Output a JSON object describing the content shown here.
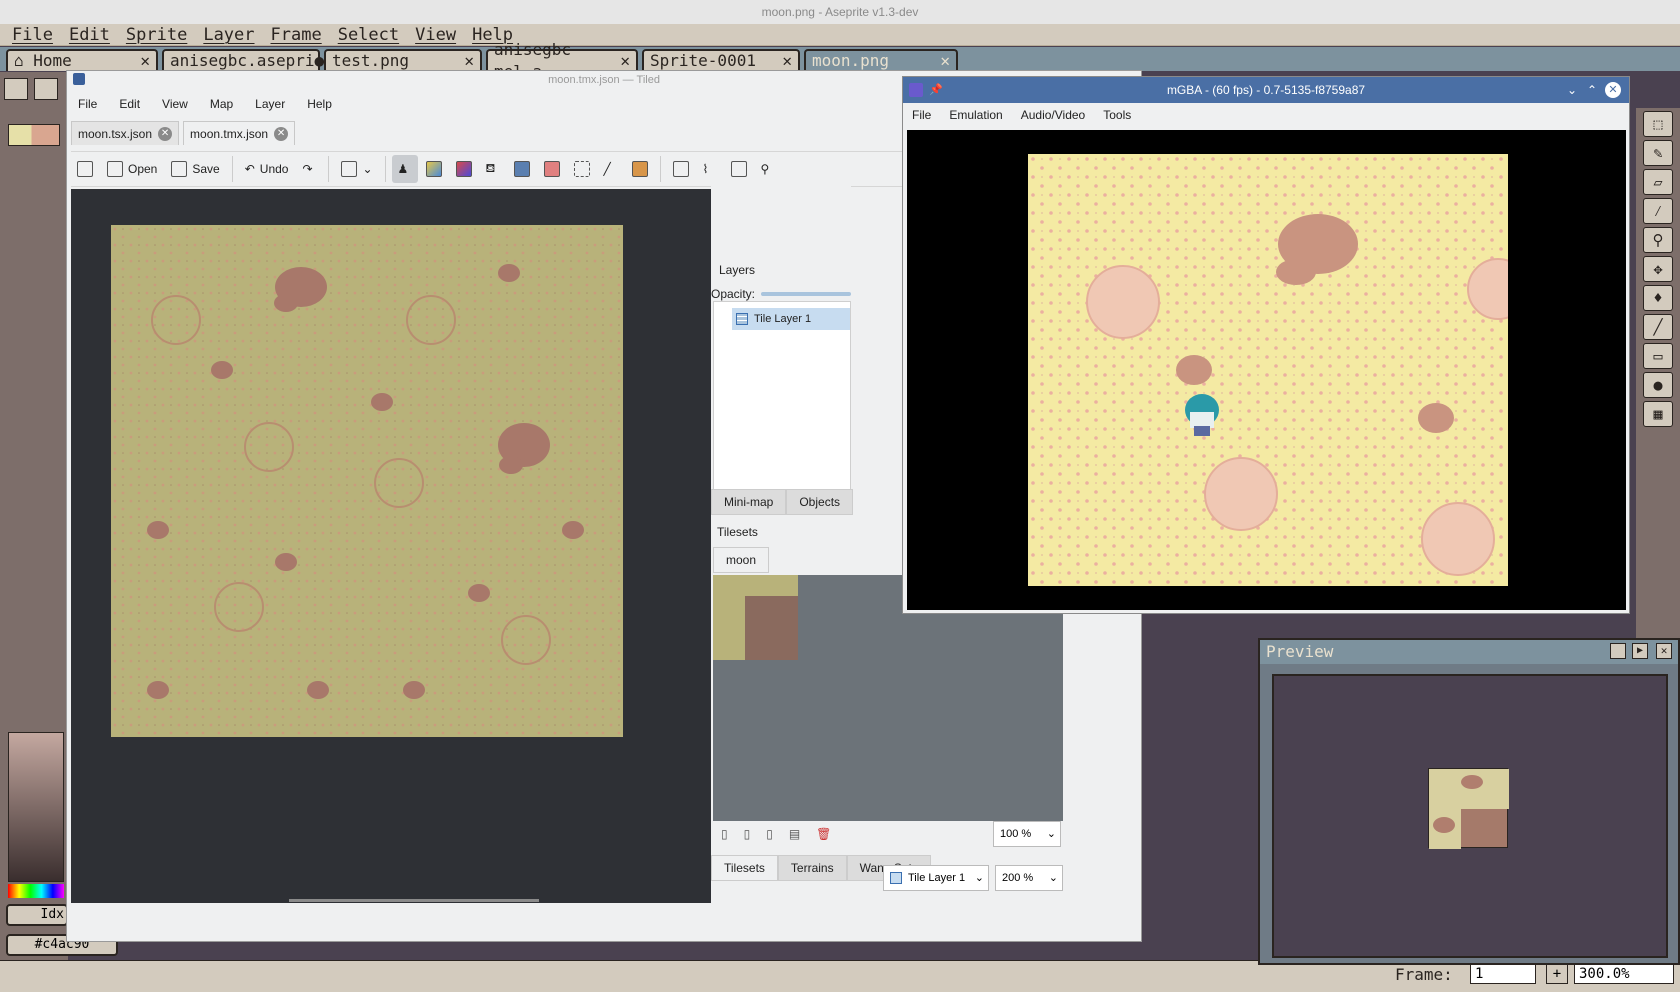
{
  "aseprite": {
    "window_title": "moon.png - Aseprite v1.3-dev",
    "menu": [
      "File",
      "Edit",
      "Sprite",
      "Layer",
      "Frame",
      "Select",
      "View",
      "Help"
    ],
    "tabs": [
      {
        "label": "Home",
        "icon": "home-icon",
        "close": "✕"
      },
      {
        "label": "anisegbc.asepri",
        "close": "●"
      },
      {
        "label": "test.png",
        "close": "✕"
      },
      {
        "label": "anisegbc-mel.a",
        "close": "✕"
      },
      {
        "label": "Sprite-0001",
        "close": "✕"
      },
      {
        "label": "moon.png",
        "close": "✕"
      }
    ],
    "left_labels": {
      "idx": "Idx",
      "color_hex": "#c4ac90"
    },
    "bottom": {
      "frame_label": "Frame:",
      "frame_value": "1",
      "zoom": "300.0%"
    },
    "preview_title": "Preview"
  },
  "tiled": {
    "window_title": "moon.tmx.json — Tiled",
    "menu": [
      "File",
      "Edit",
      "View",
      "Map",
      "Layer",
      "Help"
    ],
    "tabs": [
      "moon.tsx.json",
      "moon.tmx.json"
    ],
    "toolbar": {
      "open": "Open",
      "save": "Save",
      "undo": "Undo"
    },
    "layers": {
      "title": "Layers",
      "opacity_label": "Opacity:",
      "items": [
        "Tile Layer 1"
      ]
    },
    "panel_tabs": [
      "Mini-map",
      "Objects"
    ],
    "tilesets": {
      "title": "Tilesets",
      "tab": "moon",
      "zoom": "100 %"
    },
    "bottom_tabs": [
      "Tilesets",
      "Terrains",
      "Wang Sets"
    ],
    "status": {
      "layer": "Tile Layer 1",
      "zoom": "200 %"
    }
  },
  "mgba": {
    "window_title": "mGBA - (60 fps) - 0.7-5135-f8759a87",
    "menu": [
      "File",
      "Emulation",
      "Audio/Video",
      "Tools"
    ]
  },
  "colors": {
    "ase_panel": "#d3cbbe",
    "ase_tab_active": "#7d929e",
    "tiled_bg": "#eff0f1",
    "map_bg": "#b8b27a",
    "rock": "#b07e6e",
    "gb_bg": "#f4eaa3",
    "gb_rock": "#d9a690"
  }
}
